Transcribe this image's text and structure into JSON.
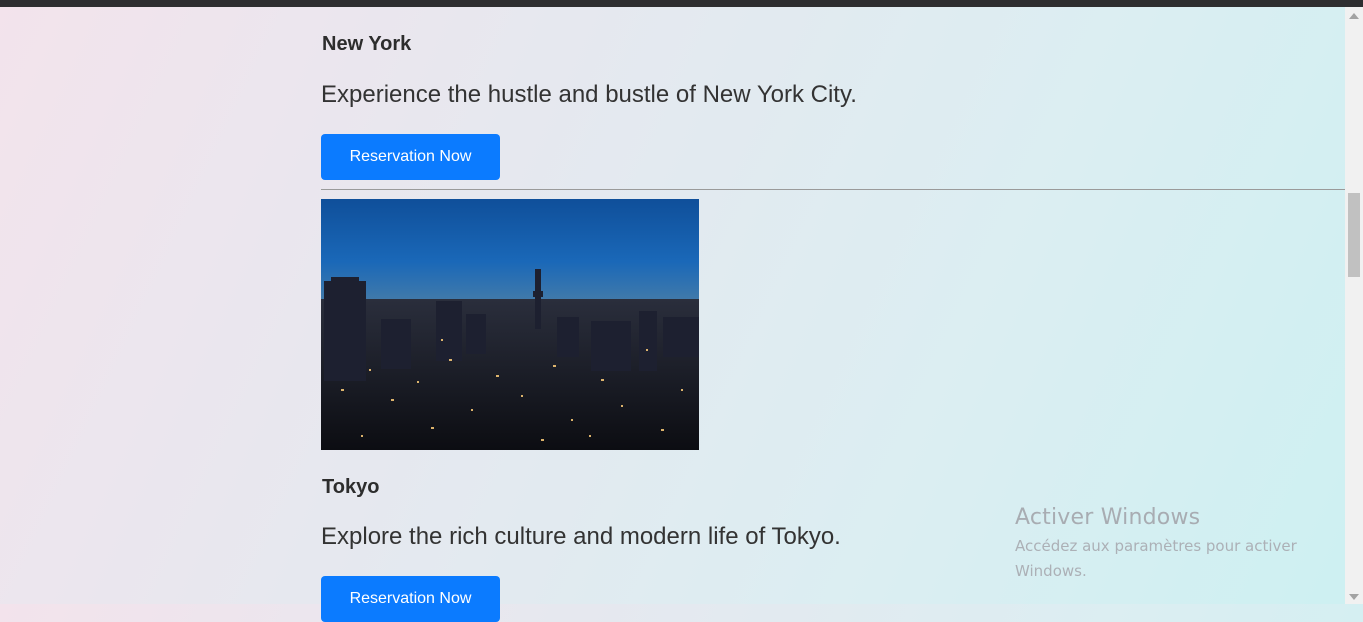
{
  "destinations": [
    {
      "title": "New York",
      "description": "Experience the hustle and bustle of New York City.",
      "button_label": "Reservation Now"
    },
    {
      "title": "Tokyo",
      "description": "Explore the rich culture and modern life of Tokyo.",
      "button_label": "Reservation Now"
    }
  ],
  "watermark": {
    "title": "Activer Windows",
    "subtitle": "Accédez aux paramètres pour activer Windows."
  },
  "colors": {
    "button": "#0b7bff",
    "text": "#333333"
  }
}
